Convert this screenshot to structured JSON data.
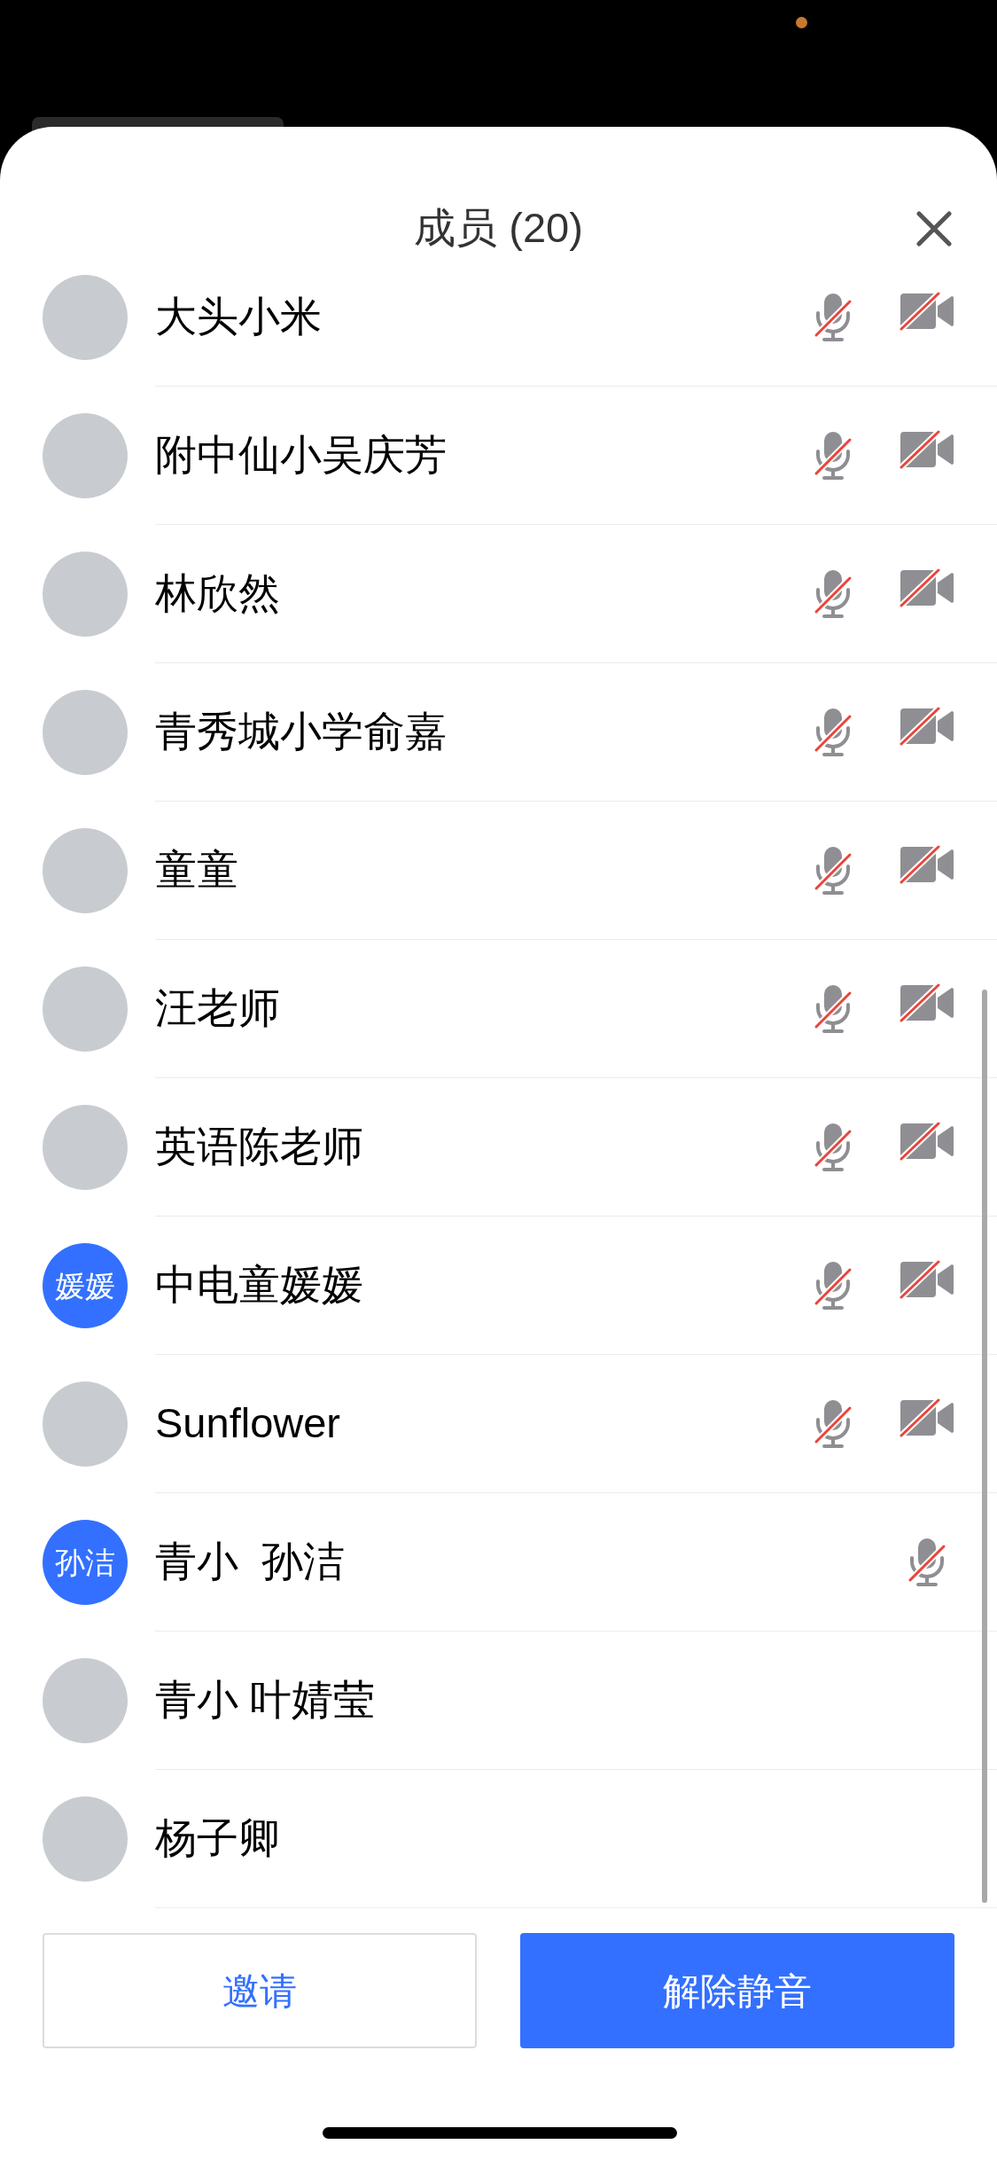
{
  "title": "成员 (20)",
  "members": [
    {
      "name": "大头小米",
      "avatar": {
        "kind": "photo"
      },
      "mic_off": true,
      "camera_off": true
    },
    {
      "name": "附中仙小吴庆芳",
      "avatar": {
        "kind": "photo"
      },
      "mic_off": true,
      "camera_off": true
    },
    {
      "name": "林欣然",
      "avatar": {
        "kind": "photo"
      },
      "mic_off": true,
      "camera_off": true
    },
    {
      "name": "青秀城小学俞嘉",
      "avatar": {
        "kind": "photo"
      },
      "mic_off": true,
      "camera_off": true
    },
    {
      "name": "童童",
      "avatar": {
        "kind": "photo"
      },
      "mic_off": true,
      "camera_off": true
    },
    {
      "name": "汪老师",
      "avatar": {
        "kind": "photo"
      },
      "mic_off": true,
      "camera_off": true
    },
    {
      "name": "英语陈老师",
      "avatar": {
        "kind": "photo"
      },
      "mic_off": true,
      "camera_off": true
    },
    {
      "name": "中电童媛媛",
      "avatar": {
        "kind": "initials",
        "text": "媛媛"
      },
      "mic_off": true,
      "camera_off": true
    },
    {
      "name": "Sunflower",
      "avatar": {
        "kind": "photo"
      },
      "mic_off": true,
      "camera_off": true
    },
    {
      "name": "青小  孙洁",
      "avatar": {
        "kind": "initials",
        "text": "孙洁"
      },
      "mic_off": true,
      "camera_off": false
    },
    {
      "name": "青小 叶婧莹",
      "avatar": {
        "kind": "photo"
      },
      "mic_off": false,
      "camera_off": false
    },
    {
      "name": "杨子卿",
      "avatar": {
        "kind": "photo"
      },
      "mic_off": false,
      "camera_off": false
    }
  ],
  "buttons": {
    "invite": "邀请",
    "unmute": "解除静音"
  }
}
